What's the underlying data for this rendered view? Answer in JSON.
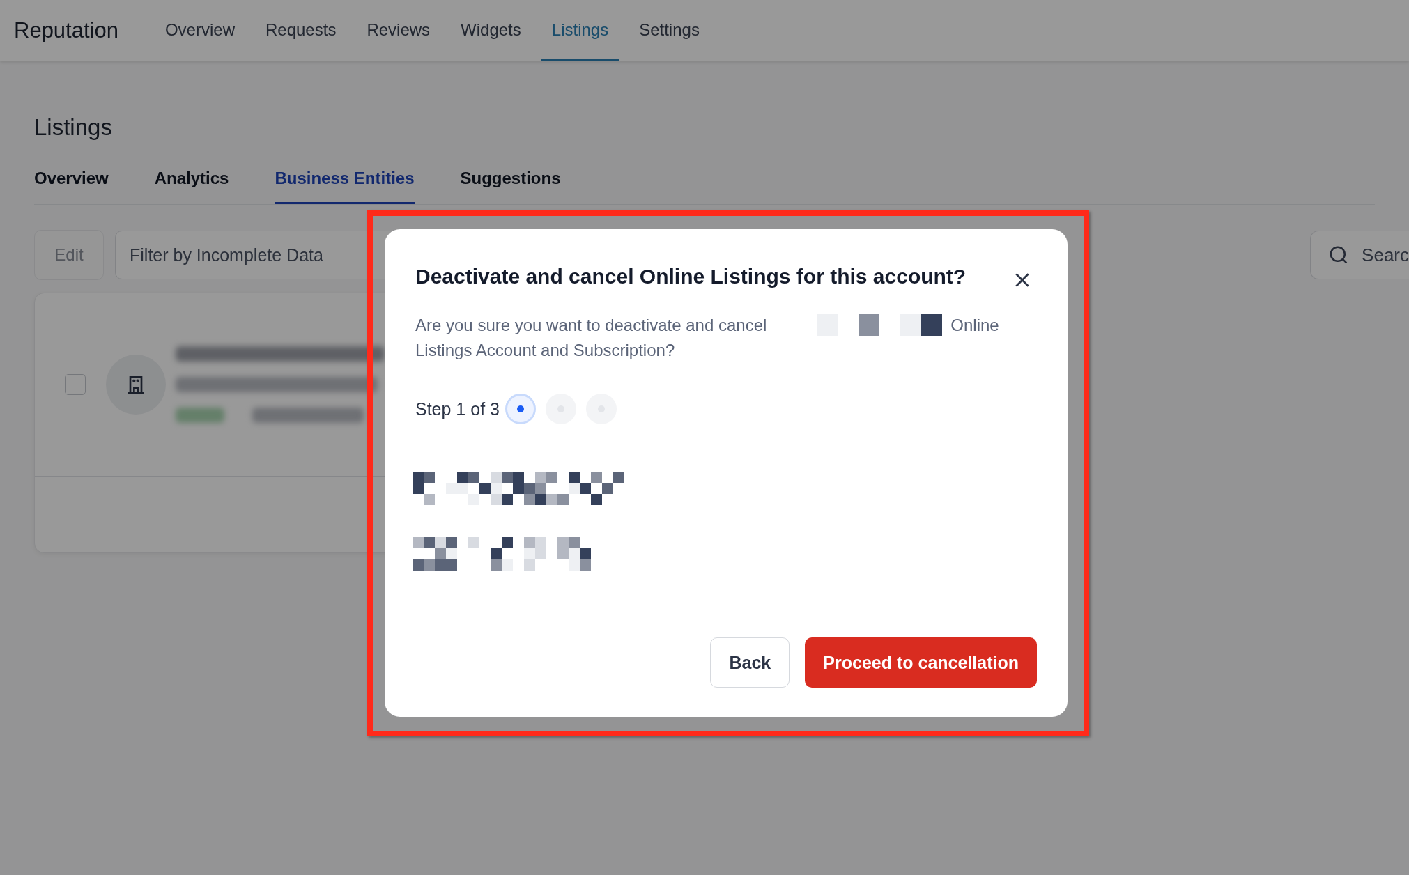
{
  "app": {
    "title": "Reputation"
  },
  "nav": [
    {
      "label": "Overview",
      "selected": false
    },
    {
      "label": "Requests",
      "selected": false
    },
    {
      "label": "Reviews",
      "selected": false
    },
    {
      "label": "Widgets",
      "selected": false
    },
    {
      "label": "Listings",
      "selected": true
    },
    {
      "label": "Settings",
      "selected": false
    }
  ],
  "page": {
    "title": "Listings"
  },
  "tabs": [
    {
      "label": "Overview",
      "selected": false
    },
    {
      "label": "Analytics",
      "selected": false
    },
    {
      "label": "Business Entities",
      "selected": true
    },
    {
      "label": "Suggestions",
      "selected": false
    }
  ],
  "toolbar": {
    "edit_button": "Edit",
    "filter": "Filter by Incomplete Data",
    "search": {
      "placeholder": "Searc"
    }
  },
  "card": {
    "checked": false
  },
  "dialog": {
    "title": "Deactivate and cancel Online Listings for this account?",
    "message_start": "Are you sure you want to deactivate and cancel",
    "message_word": "Online",
    "message_end": "Listings Account and Subscription?",
    "step": "Step 1 of 3",
    "steps": [
      {
        "selected": true
      },
      {
        "selected": false
      },
      {
        "selected": false
      }
    ],
    "buttons": [
      {
        "label": "Back",
        "kind": "secondary"
      },
      {
        "label": "Proceed to cancellation",
        "kind": "danger"
      }
    ]
  }
}
